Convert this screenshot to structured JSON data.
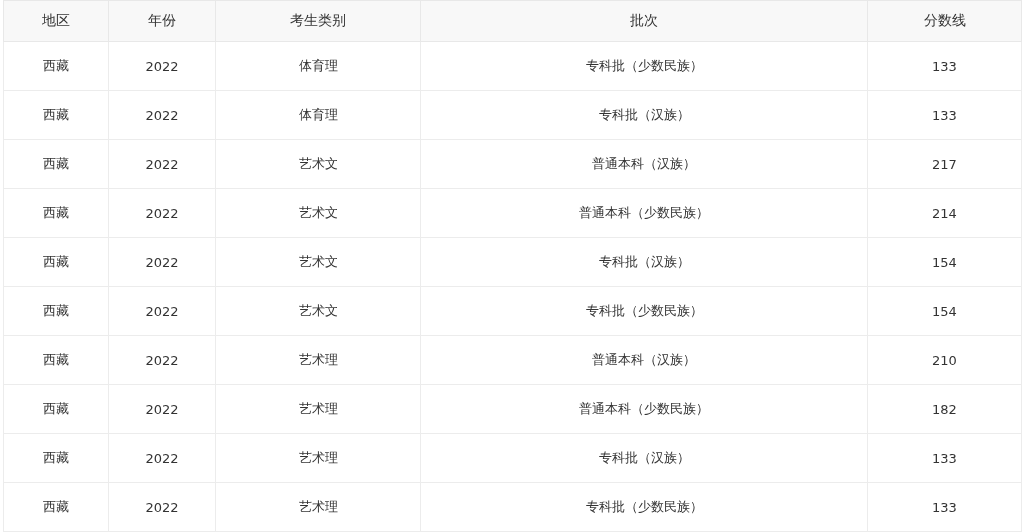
{
  "table": {
    "columns": [
      "地区",
      "年份",
      "考生类别",
      "批次",
      "分数线"
    ],
    "rows": [
      [
        "西藏",
        "2022",
        "体育理",
        "专科批（少数民族）",
        "133"
      ],
      [
        "西藏",
        "2022",
        "体育理",
        "专科批（汉族）",
        "133"
      ],
      [
        "西藏",
        "2022",
        "艺术文",
        "普通本科（汉族）",
        "217"
      ],
      [
        "西藏",
        "2022",
        "艺术文",
        "普通本科（少数民族）",
        "214"
      ],
      [
        "西藏",
        "2022",
        "艺术文",
        "专科批（汉族）",
        "154"
      ],
      [
        "西藏",
        "2022",
        "艺术文",
        "专科批（少数民族）",
        "154"
      ],
      [
        "西藏",
        "2022",
        "艺术理",
        "普通本科（汉族）",
        "210"
      ],
      [
        "西藏",
        "2022",
        "艺术理",
        "普通本科（少数民族）",
        "182"
      ],
      [
        "西藏",
        "2022",
        "艺术理",
        "专科批（汉族）",
        "133"
      ],
      [
        "西藏",
        "2022",
        "艺术理",
        "专科批（少数民族）",
        "133"
      ]
    ]
  }
}
